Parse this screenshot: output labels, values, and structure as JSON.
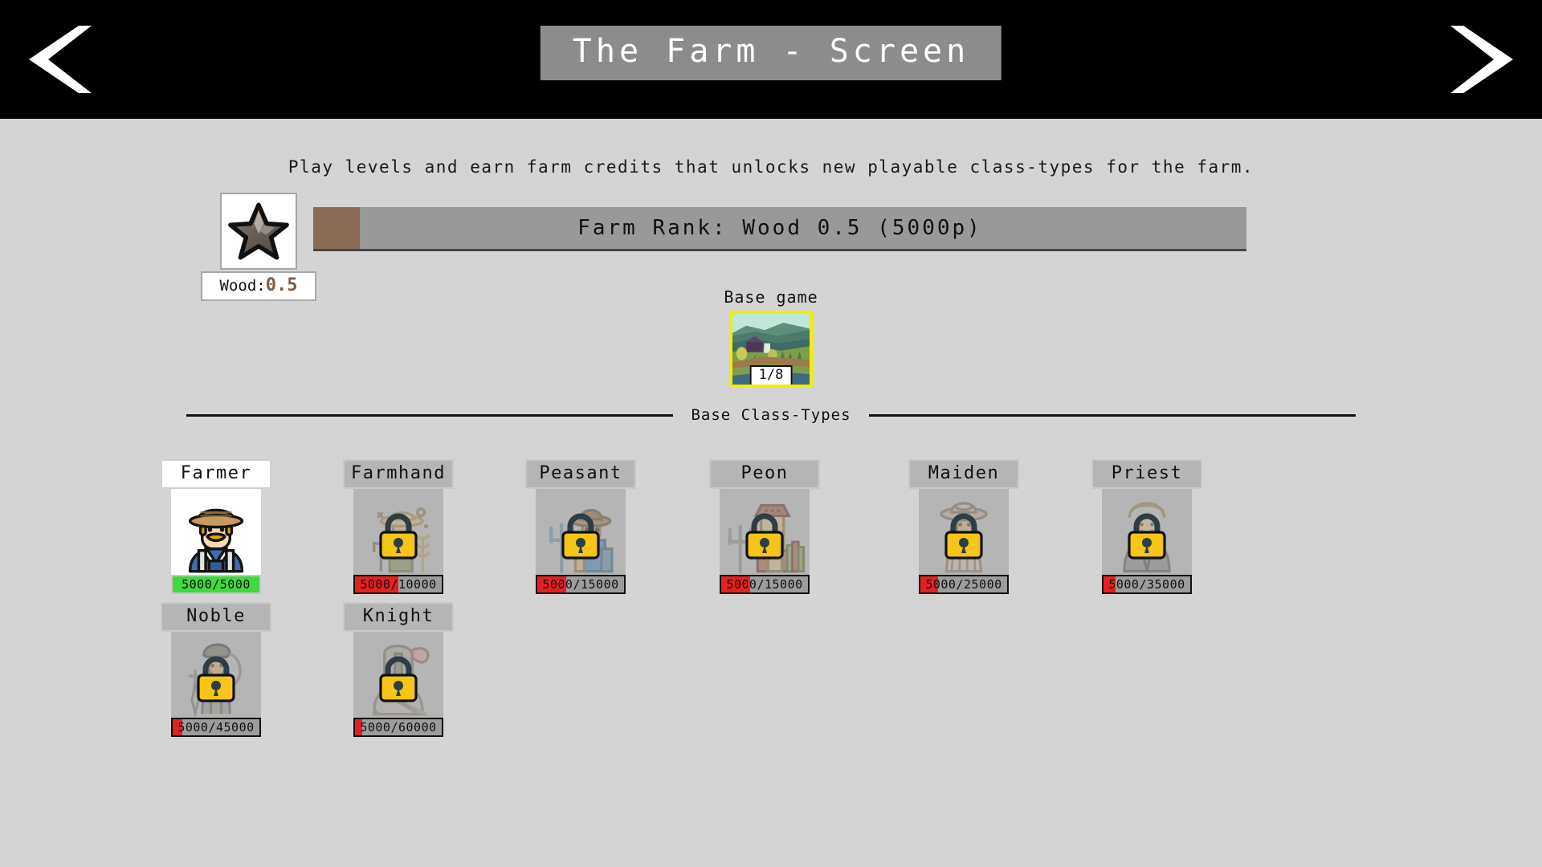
{
  "header": {
    "title": "The Farm - Screen",
    "prev_icon": "chevron-left-icon",
    "next_icon": "chevron-right-icon"
  },
  "description": "Play levels and earn farm credits that unlocks new playable class-types for the farm.",
  "rank": {
    "badge_icon": "wood-star-icon",
    "badge_label_prefix": "Wood:",
    "badge_label_value": "0.5",
    "bar_text": "Farm Rank: Wood 0.5 (5000p)",
    "progress_percent": 5,
    "fill_color": "#8a6b55",
    "track_color": "#999999"
  },
  "pack": {
    "title": "Base game",
    "count": "1/8",
    "border_color": "#f2ee00"
  },
  "divider": {
    "label": "Base Class-Types"
  },
  "classes": [
    {
      "name": "Farmer",
      "progress_text": "5000/5000",
      "current": 5000,
      "required": 5000,
      "percent": 100,
      "unlocked": true,
      "portrait": "farmer-portrait",
      "bar_color": "#3ddb3d"
    },
    {
      "name": "Farmhand",
      "progress_text": "5000/10000",
      "current": 5000,
      "required": 10000,
      "percent": 50,
      "unlocked": false,
      "portrait": "farmhand-portrait",
      "bar_color": "#e52020"
    },
    {
      "name": "Peasant",
      "progress_text": "5000/15000",
      "current": 5000,
      "required": 15000,
      "percent": 33,
      "unlocked": false,
      "portrait": "peasant-portrait",
      "bar_color": "#e52020"
    },
    {
      "name": "Peon",
      "progress_text": "5000/15000",
      "current": 5000,
      "required": 15000,
      "percent": 33,
      "unlocked": false,
      "portrait": "peon-portrait",
      "bar_color": "#e52020"
    },
    {
      "name": "Maiden",
      "progress_text": "5000/25000",
      "current": 5000,
      "required": 25000,
      "percent": 20,
      "unlocked": false,
      "portrait": "maiden-portrait",
      "bar_color": "#e52020"
    },
    {
      "name": "Priest",
      "progress_text": "5000/35000",
      "current": 5000,
      "required": 35000,
      "percent": 14,
      "unlocked": false,
      "portrait": "priest-portrait",
      "bar_color": "#e52020"
    },
    {
      "name": "Noble",
      "progress_text": "5000/45000",
      "current": 5000,
      "required": 45000,
      "percent": 11,
      "unlocked": false,
      "portrait": "noble-portrait",
      "bar_color": "#e52020"
    },
    {
      "name": "Knight",
      "progress_text": "5000/60000",
      "current": 5000,
      "required": 60000,
      "percent": 8,
      "unlocked": false,
      "portrait": "knight-portrait",
      "bar_color": "#e52020"
    }
  ],
  "colors": {
    "page_background": "#d4d4d4",
    "header_background": "#000000",
    "title_background": "#8c8c8c",
    "card_locked_background": "#b5b5b5",
    "card_unlocked_background": "#ffffff",
    "lock_color": "#f5c518"
  }
}
